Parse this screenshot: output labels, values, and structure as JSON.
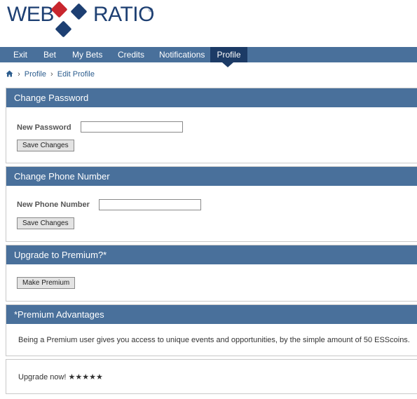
{
  "logo": {
    "word_left": "WEB",
    "word_right": "RATIO",
    "registered": "®"
  },
  "nav": {
    "items": [
      {
        "label": "Exit"
      },
      {
        "label": "Bet"
      },
      {
        "label": "My Bets"
      },
      {
        "label": "Credits"
      },
      {
        "label": "Notifications"
      },
      {
        "label": "Profile",
        "active": true
      }
    ]
  },
  "breadcrumb": {
    "items": [
      "Profile",
      "Edit Profile"
    ],
    "separator": "›"
  },
  "change_password": {
    "title": "Change Password",
    "label": "New Password",
    "value": "",
    "button": "Save Changes"
  },
  "change_phone": {
    "title": "Change Phone Number",
    "label": "New Phone Number",
    "value": "",
    "button": "Save Changes"
  },
  "upgrade": {
    "title": "Upgrade to Premium?*",
    "button": "Make Premium"
  },
  "advantages": {
    "title": "*Premium Advantages",
    "text": "Being a Premium user gives you access to unique events and opportunities, by the simple amount of 50 ESScoins."
  },
  "cta": {
    "text": "Upgrade now! ★★★★★"
  },
  "colors": {
    "brand_blue": "#1d3f72",
    "brand_red": "#c8262e",
    "nav_bg": "#49709b",
    "nav_active": "#1c3b66"
  }
}
